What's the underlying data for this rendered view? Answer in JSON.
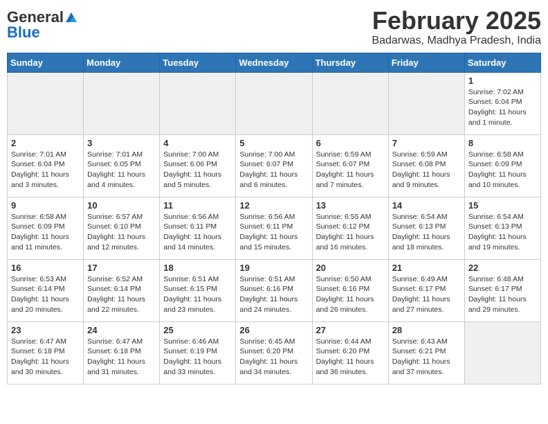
{
  "header": {
    "logo_general": "General",
    "logo_blue": "Blue",
    "main_title": "February 2025",
    "sub_title": "Badarwas, Madhya Pradesh, India"
  },
  "calendar": {
    "days_of_week": [
      "Sunday",
      "Monday",
      "Tuesday",
      "Wednesday",
      "Thursday",
      "Friday",
      "Saturday"
    ],
    "weeks": [
      [
        {
          "day": "",
          "info": ""
        },
        {
          "day": "",
          "info": ""
        },
        {
          "day": "",
          "info": ""
        },
        {
          "day": "",
          "info": ""
        },
        {
          "day": "",
          "info": ""
        },
        {
          "day": "",
          "info": ""
        },
        {
          "day": "1",
          "info": "Sunrise: 7:02 AM\nSunset: 6:04 PM\nDaylight: 11 hours and 1 minute."
        }
      ],
      [
        {
          "day": "2",
          "info": "Sunrise: 7:01 AM\nSunset: 6:04 PM\nDaylight: 11 hours and 3 minutes."
        },
        {
          "day": "3",
          "info": "Sunrise: 7:01 AM\nSunset: 6:05 PM\nDaylight: 11 hours and 4 minutes."
        },
        {
          "day": "4",
          "info": "Sunrise: 7:00 AM\nSunset: 6:06 PM\nDaylight: 11 hours and 5 minutes."
        },
        {
          "day": "5",
          "info": "Sunrise: 7:00 AM\nSunset: 6:07 PM\nDaylight: 11 hours and 6 minutes."
        },
        {
          "day": "6",
          "info": "Sunrise: 6:59 AM\nSunset: 6:07 PM\nDaylight: 11 hours and 7 minutes."
        },
        {
          "day": "7",
          "info": "Sunrise: 6:59 AM\nSunset: 6:08 PM\nDaylight: 11 hours and 9 minutes."
        },
        {
          "day": "8",
          "info": "Sunrise: 6:58 AM\nSunset: 6:09 PM\nDaylight: 11 hours and 10 minutes."
        }
      ],
      [
        {
          "day": "9",
          "info": "Sunrise: 6:58 AM\nSunset: 6:09 PM\nDaylight: 11 hours and 11 minutes."
        },
        {
          "day": "10",
          "info": "Sunrise: 6:57 AM\nSunset: 6:10 PM\nDaylight: 11 hours and 12 minutes."
        },
        {
          "day": "11",
          "info": "Sunrise: 6:56 AM\nSunset: 6:11 PM\nDaylight: 11 hours and 14 minutes."
        },
        {
          "day": "12",
          "info": "Sunrise: 6:56 AM\nSunset: 6:11 PM\nDaylight: 11 hours and 15 minutes."
        },
        {
          "day": "13",
          "info": "Sunrise: 6:55 AM\nSunset: 6:12 PM\nDaylight: 11 hours and 16 minutes."
        },
        {
          "day": "14",
          "info": "Sunrise: 6:54 AM\nSunset: 6:13 PM\nDaylight: 11 hours and 18 minutes."
        },
        {
          "day": "15",
          "info": "Sunrise: 6:54 AM\nSunset: 6:13 PM\nDaylight: 11 hours and 19 minutes."
        }
      ],
      [
        {
          "day": "16",
          "info": "Sunrise: 6:53 AM\nSunset: 6:14 PM\nDaylight: 11 hours and 20 minutes."
        },
        {
          "day": "17",
          "info": "Sunrise: 6:52 AM\nSunset: 6:14 PM\nDaylight: 11 hours and 22 minutes."
        },
        {
          "day": "18",
          "info": "Sunrise: 6:51 AM\nSunset: 6:15 PM\nDaylight: 11 hours and 23 minutes."
        },
        {
          "day": "19",
          "info": "Sunrise: 6:51 AM\nSunset: 6:16 PM\nDaylight: 11 hours and 24 minutes."
        },
        {
          "day": "20",
          "info": "Sunrise: 6:50 AM\nSunset: 6:16 PM\nDaylight: 11 hours and 26 minutes."
        },
        {
          "day": "21",
          "info": "Sunrise: 6:49 AM\nSunset: 6:17 PM\nDaylight: 11 hours and 27 minutes."
        },
        {
          "day": "22",
          "info": "Sunrise: 6:48 AM\nSunset: 6:17 PM\nDaylight: 11 hours and 29 minutes."
        }
      ],
      [
        {
          "day": "23",
          "info": "Sunrise: 6:47 AM\nSunset: 6:18 PM\nDaylight: 11 hours and 30 minutes."
        },
        {
          "day": "24",
          "info": "Sunrise: 6:47 AM\nSunset: 6:18 PM\nDaylight: 11 hours and 31 minutes."
        },
        {
          "day": "25",
          "info": "Sunrise: 6:46 AM\nSunset: 6:19 PM\nDaylight: 11 hours and 33 minutes."
        },
        {
          "day": "26",
          "info": "Sunrise: 6:45 AM\nSunset: 6:20 PM\nDaylight: 11 hours and 34 minutes."
        },
        {
          "day": "27",
          "info": "Sunrise: 6:44 AM\nSunset: 6:20 PM\nDaylight: 11 hours and 36 minutes."
        },
        {
          "day": "28",
          "info": "Sunrise: 6:43 AM\nSunset: 6:21 PM\nDaylight: 11 hours and 37 minutes."
        },
        {
          "day": "",
          "info": ""
        }
      ]
    ]
  }
}
